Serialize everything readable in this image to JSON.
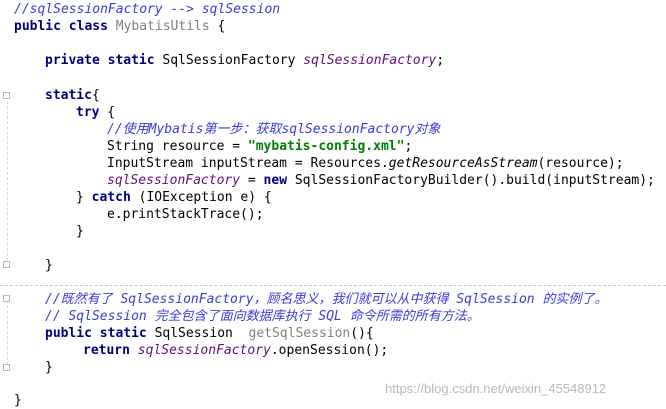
{
  "code": {
    "line1": {
      "comment": "//sqlSessionFactory --> sqlSession"
    },
    "line2": {
      "kw": "public class ",
      "class_name": "MybatisUtils",
      "brace": " {"
    },
    "line3": {
      "kw": "private static ",
      "type": "SqlSessionFactory ",
      "field": "sqlSessionFactory",
      "end": ";"
    },
    "line4": {
      "kw": "static",
      "brace": "{"
    },
    "line5": {
      "kw": "try",
      "brace": " {"
    },
    "line6": {
      "comment": "//使用Mybatis第一步：获取sqlSessionFactory对象"
    },
    "line7": {
      "decl": "String resource = ",
      "str": "\"mybatis-config.xml\"",
      "end": ";"
    },
    "line8": {
      "decl": "InputStream inputStream = Resources.",
      "method": "getResourceAsStream",
      "end": "(resource);"
    },
    "line9": {
      "field": "sqlSessionFactory",
      "mid": " = ",
      "kw": "new",
      "rest": " SqlSessionFactoryBuilder().build(inputStream);"
    },
    "line10": {
      "pre": "} ",
      "kw": "catch",
      "rest": " (IOException e) {"
    },
    "line11": {
      "text": "e.printStackTrace();"
    },
    "line12": {
      "text": "}"
    },
    "line13": {
      "text": "}"
    },
    "line14": {
      "comment": "//既然有了 SqlSessionFactory，顾名思义，我们就可以从中获得 SqlSession 的实例了。"
    },
    "line15": {
      "comment": "// SqlSession 完全包含了面向数据库执行 SQL 命令所需的所有方法。"
    },
    "line16": {
      "kw": "public static ",
      "type": "SqlSession  ",
      "method": "getSqlSession",
      "end": "(){"
    },
    "line17": {
      "kw": "return ",
      "field": "sqlSessionFactory",
      "end": ".openSession();"
    },
    "line18": {
      "text": "}"
    },
    "line19": {
      "text": "}"
    }
  },
  "watermark": "https://blog.csdn.net/weixin_45548912"
}
